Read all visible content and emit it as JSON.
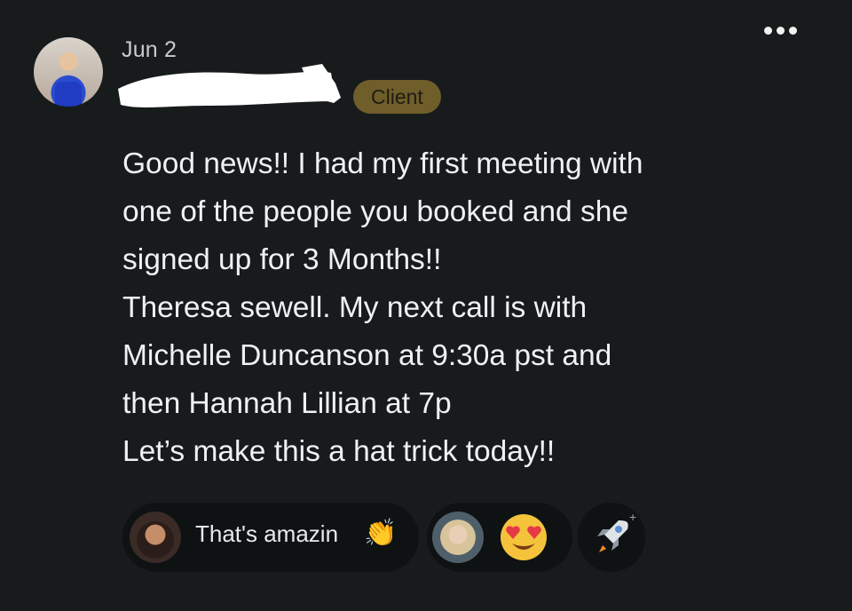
{
  "post": {
    "date": "Jun 2",
    "badge": "Client",
    "body_lines": [
      "Good news!! I had my first meeting with",
      "one of the people you booked and she",
      "signed up for 3 Months!!",
      "Theresa sewell. My next call is with",
      "Michelle Duncanson at 9:30a pst and",
      "then Hannah Lillian at 7p",
      "Let’s make this a hat trick today!!"
    ]
  },
  "reactions": {
    "reply_text": "That's amazin",
    "reply_emoji": "👏",
    "combo_emoji": "😍"
  },
  "icons": {
    "more": "more-options-icon",
    "clap": "clapping-hands-icon",
    "heart_eyes": "heart-eyes-icon",
    "rocket": "rocket-icon"
  }
}
